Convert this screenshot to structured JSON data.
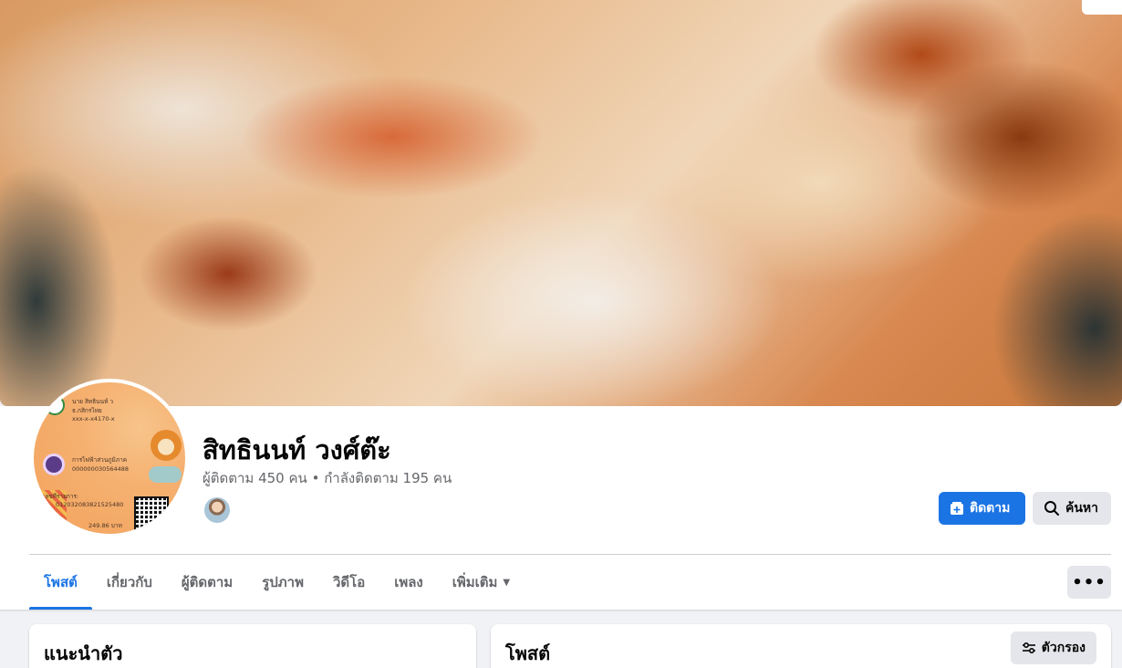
{
  "profile": {
    "name": "สิทธินนท์ วงศ์ต๊ะ",
    "followers": "ผู้ติดตาม 450 คน",
    "separator": "•",
    "following": "กำลังติดตาม 195 คน"
  },
  "avatar_card": {
    "line1": "นาย สิทธินนท์ ว",
    "line2": "ธ.กสิกรไทย",
    "line3": "xxx-x-x4170-x",
    "line4": "การไฟฟ้าส่วนภูมิภาค",
    "line5": "000000030564488",
    "line6": "เลขที่รายการ:",
    "line7": "012032083821525480",
    "line8": "249.86 บาท"
  },
  "actions": {
    "follow_label": "ติดตาม",
    "search_label": "ค้นหา",
    "more_label": "•••"
  },
  "tabs": [
    {
      "label": "โพสต์"
    },
    {
      "label": "เกี่ยวกับ"
    },
    {
      "label": "ผู้ติดตาม"
    },
    {
      "label": "รูปภาพ"
    },
    {
      "label": "วิดีโอ"
    },
    {
      "label": "เพลง"
    },
    {
      "label": "เพิ่มเติม"
    }
  ],
  "intro": {
    "title": "แนะนำตัว"
  },
  "posts": {
    "title": "โพสต์",
    "filter_label": "ตัวกรอง"
  },
  "colors": {
    "accent": "#1b74e4",
    "muted": "#65676b",
    "bg": "#f0f2f5"
  }
}
